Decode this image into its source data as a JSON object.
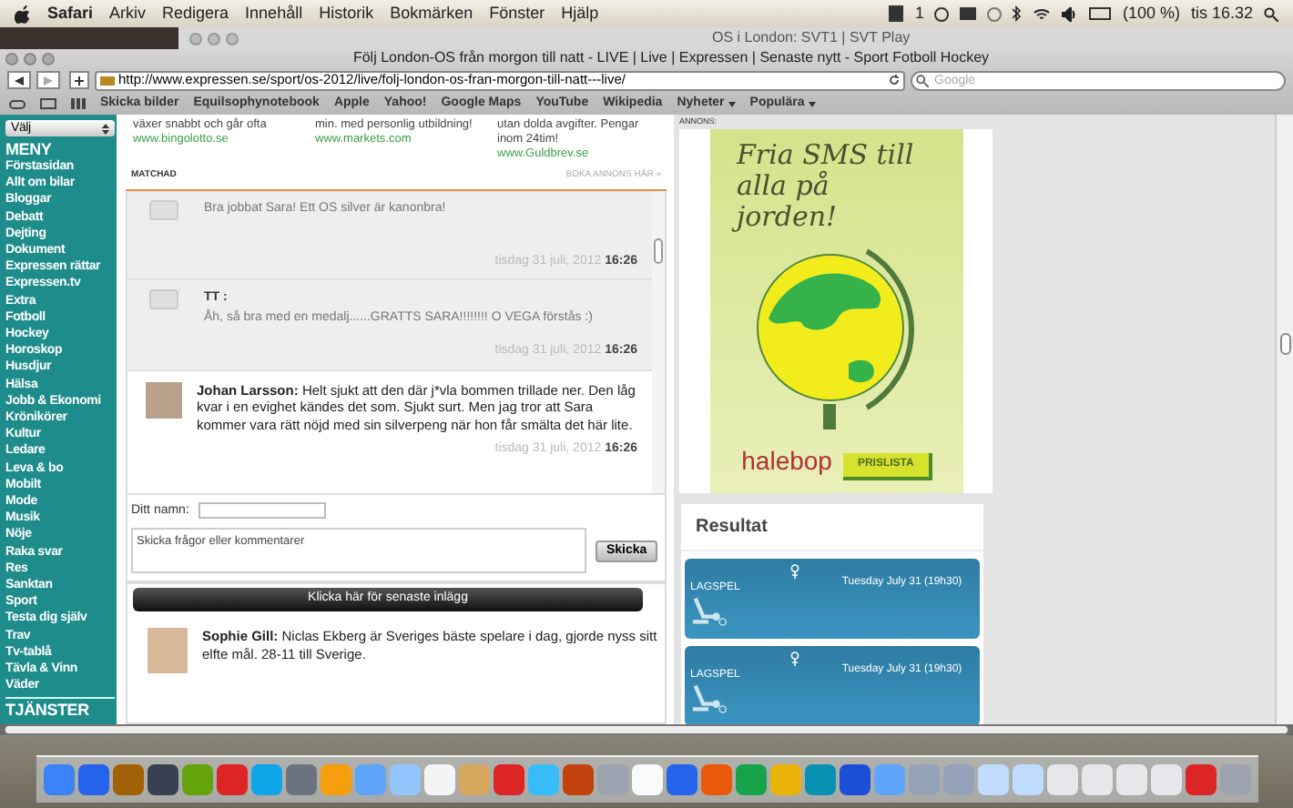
{
  "menu_bar": {
    "app": "Safari",
    "items": [
      "Arkiv",
      "Redigera",
      "Innehåll",
      "Historik",
      "Bokmärken",
      "Fönster",
      "Hjälp"
    ],
    "status": {
      "count": "1",
      "battery": "(100 %)",
      "clock": "tis 16.32"
    }
  },
  "background_window": {
    "title": "OS i London: SVT1 | SVT Play"
  },
  "window": {
    "title": "Följ London-OS från morgon till natt - LIVE | Live | Expressen | Senaste nytt - Sport Fotboll Hockey",
    "url": "http://www.expressen.se/sport/os-2012/live/folj-london-os-fran-morgon-till-natt---live/",
    "search_placeholder": "Google"
  },
  "bookmarks": [
    {
      "label": "Skicka bilder",
      "menu": false
    },
    {
      "label": "Equilsophynotebook",
      "menu": false
    },
    {
      "label": "Apple",
      "menu": false
    },
    {
      "label": "Yahoo!",
      "menu": false
    },
    {
      "label": "Google Maps",
      "menu": false
    },
    {
      "label": "YouTube",
      "menu": false
    },
    {
      "label": "Wikipedia",
      "menu": false
    },
    {
      "label": "Nyheter",
      "menu": true
    },
    {
      "label": "Populära",
      "menu": true
    }
  ],
  "sidebar": {
    "select": "Välj",
    "heading": "MENY",
    "items": [
      "Förstasidan",
      "Allt om bilar",
      "Bloggar",
      "Debatt",
      "Dejting",
      "Dokument",
      "Expressen rättar",
      "Expressen.tv",
      "Extra",
      "Fotboll",
      "Hockey",
      "Horoskop",
      "Husdjur",
      "Hälsa",
      "Jobb & Ekonomi",
      "Krönikörer",
      "Kultur",
      "Ledare",
      "Leva & bo",
      "Mobilt",
      "Mode",
      "Musik",
      "Nöje",
      "Raka svar",
      "Res",
      "Sanktan",
      "Sport",
      "Testa dig själv",
      "Trav",
      "Tv-tablå",
      "Tävla & Vinn",
      "Väder"
    ],
    "heading_2": "TJÄNSTER"
  },
  "ads": [
    {
      "text": "växer snabbt och går ofta",
      "link": "www.bingolotto.se"
    },
    {
      "text": "min. med personlig utbildning!",
      "link": "www.markets.com"
    },
    {
      "text": "utan dolda avgifter. Pengar inom 24tim!",
      "link": "www.Guldbrev.se"
    }
  ],
  "ads_label": "MATCHAD",
  "ads_book": "BOKA ANNONS HÄR »",
  "comments": [
    {
      "kind": "reader",
      "text": "Bra jobbat Sara! Ett OS silver är kanonbra!",
      "date": "tisdag 31 juli, 2012",
      "time": "16:26"
    },
    {
      "kind": "reader",
      "author": "TT :",
      "text": "Åh, så bra med en medalj......GRATTS SARA!!!!!!!! O VEGA förstås :)",
      "date": "tisdag 31 juli, 2012",
      "time": "16:26"
    },
    {
      "kind": "reporter",
      "author": "Johan Larsson:",
      "text": "Helt sjukt att den där j*vla bommen trillade ner. Den låg kvar i en evighet kändes det som. Sjukt surt. Men jag tror att Sara kommer vara rätt nöjd med sin silverpeng när hon får smälta det här lite.",
      "date": "tisdag 31 juli, 2012",
      "time": "16:26"
    }
  ],
  "form": {
    "name_label": "Ditt namn:",
    "message_placeholder": "Skicka frågor eller kommentarer",
    "submit": "Skicka"
  },
  "latest_button": "Klicka här för senaste inlägg",
  "latest": [
    {
      "author": "Sophie Gill:",
      "text": "Niclas Ekberg är Sveriges bäste spelare i dag, gjorde nyss sitt elfte mål. 28-11 till Sverige."
    }
  ],
  "ad_label": "ANNONS:",
  "banner": {
    "headline": "Fria SMS till alla på jorden!",
    "brand": "halebop",
    "button": "PRISLISTA"
  },
  "results": {
    "title": "Resultat",
    "events": [
      {
        "sport": "LAGSPEL",
        "date": "Tuesday July 31 (19h30)"
      },
      {
        "sport": "LAGSPEL",
        "date": "Tuesday July 31 (19h30)"
      }
    ]
  }
}
